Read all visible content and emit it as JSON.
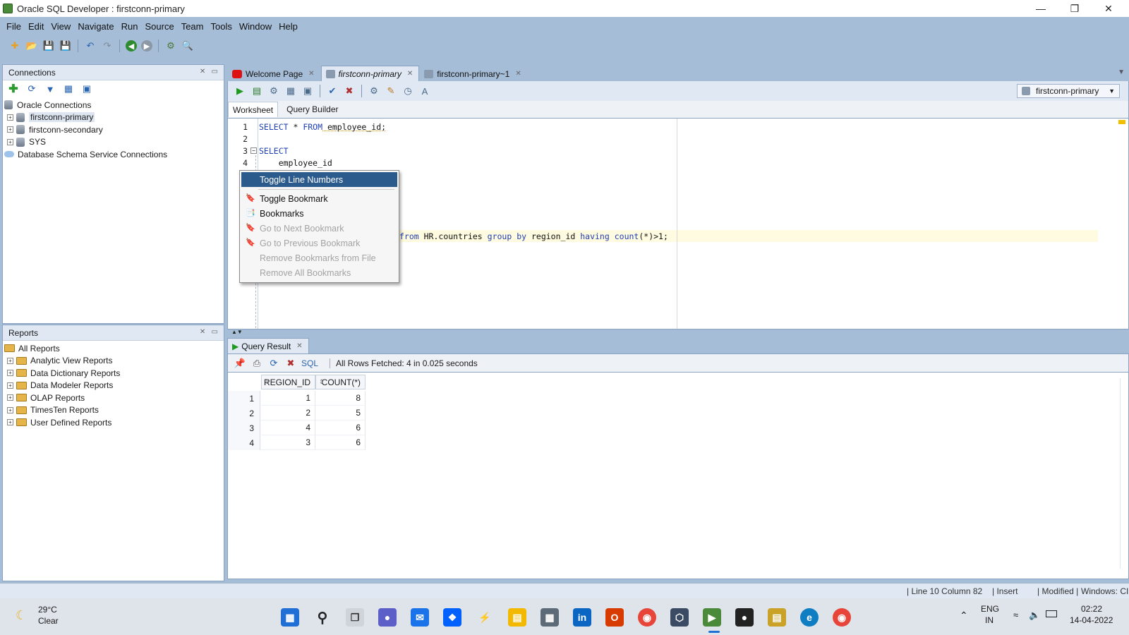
{
  "window": {
    "title": "Oracle SQL Developer : firstconn-primary"
  },
  "menu": [
    "File",
    "Edit",
    "View",
    "Navigate",
    "Run",
    "Source",
    "Team",
    "Tools",
    "Window",
    "Help"
  ],
  "connections": {
    "panel_title": "Connections",
    "root": "Oracle Connections",
    "items": [
      "firstconn-primary",
      "firstconn-secondary",
      "SYS"
    ],
    "schema_service": "Database Schema Service Connections"
  },
  "reports": {
    "panel_title": "Reports",
    "root": "All Reports",
    "items": [
      "Analytic View Reports",
      "Data Dictionary Reports",
      "Data Modeler Reports",
      "OLAP Reports",
      "TimesTen Reports",
      "User Defined Reports"
    ]
  },
  "editor_tabs": [
    "Welcome Page",
    "firstconn-primary",
    "firstconn-primary~1"
  ],
  "connection_selector": "firstconn-primary",
  "worksheet_tabs": [
    "Worksheet",
    "Query Builder"
  ],
  "code": {
    "line_numbers": [
      "1",
      "2",
      "3",
      "4"
    ],
    "line1_kw1": "SELECT",
    "line1_rest": " * ",
    "line1_kw2": "FROM",
    "line1_tail": " employee_id;",
    "line3_kw": "SELECT",
    "line4": "    employee_id",
    "line10_visible": {
      "from": "from",
      "t1": " HR.countries ",
      "group": "group",
      "by": "by",
      "t2": " region_id ",
      "having": "having",
      "count": "count",
      "t3": "(*)>1;"
    }
  },
  "context_menu": {
    "items": [
      "Toggle Line Numbers",
      "Toggle Bookmark",
      "Bookmarks",
      "Go to Next Bookmark",
      "Go to Previous Bookmark",
      "Remove Bookmarks from File",
      "Remove All Bookmarks"
    ]
  },
  "results": {
    "tab": "Query Result",
    "sql_link": "SQL",
    "status": "All Rows Fetched: 4 in 0.025 seconds",
    "columns": [
      "REGION_ID",
      "COUNT(*)"
    ],
    "rows": [
      {
        "n": "1",
        "region_id": "1",
        "count": "8"
      },
      {
        "n": "2",
        "region_id": "2",
        "count": "5"
      },
      {
        "n": "3",
        "region_id": "4",
        "count": "6"
      },
      {
        "n": "4",
        "region_id": "3",
        "count": "6"
      }
    ]
  },
  "statusbar": {
    "position": "Line 10 Column 82",
    "mode": "Insert",
    "modified": "Modified",
    "eol": "Windows: CI"
  },
  "taskbar": {
    "weather_temp": "29°C",
    "weather_desc": "Clear",
    "lang1": "ENG",
    "lang2": "IN",
    "time": "02:22",
    "date": "14-04-2022"
  }
}
